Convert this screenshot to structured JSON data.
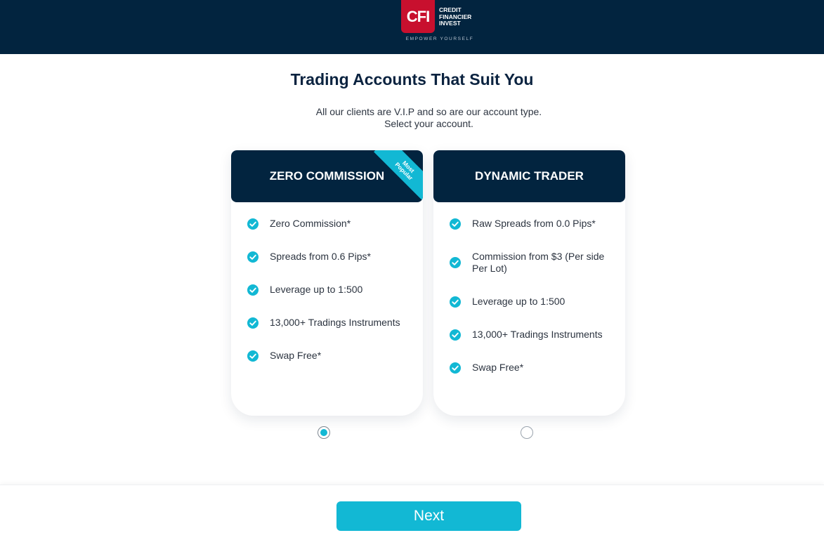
{
  "header": {
    "logo_mark": "CFI",
    "logo_words": [
      "CREDIT",
      "FINANCIER",
      "INVEST"
    ],
    "tagline": "EMPOWER YOURSELF",
    "background": "#02243f",
    "brand_red": "#c8102e"
  },
  "main": {
    "title": "Trading Accounts That Suit You",
    "subtitle_lines": [
      "All our clients are V.I.P and so are our account type.",
      "Select your account."
    ]
  },
  "accounts": [
    {
      "name": "ZERO COMMISSION",
      "badge_lines": [
        "Most",
        "Popular"
      ],
      "selected": true,
      "features": [
        "Zero Commission*",
        "Spreads from 0.6 Pips*",
        "Leverage up to 1:500",
        "13,000+ Tradings Instruments",
        "Swap Free*"
      ]
    },
    {
      "name": "DYNAMIC TRADER",
      "selected": false,
      "features": [
        "Raw Spreads from 0.0 Pips*",
        "Commission from $3 (Per side Per Lot)",
        "Leverage up to 1:500",
        "13,000+ Tradings Instruments",
        "Swap Free*"
      ]
    }
  ],
  "footer": {
    "next_label": "Next"
  },
  "icons": {
    "feature_bullet": "check-circle-icon",
    "accent": "#12b8d4"
  }
}
